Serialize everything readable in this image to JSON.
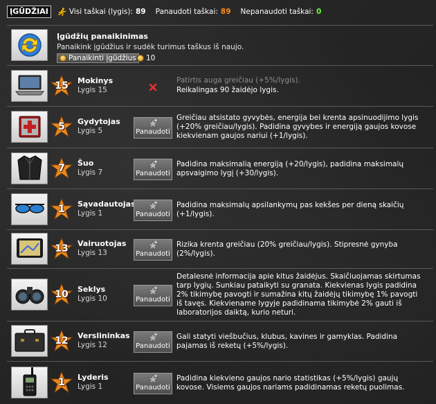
{
  "header": {
    "title": "ĮGŪDŽIAI",
    "total_label": "Visi taškai (lygis):",
    "total_value": "89",
    "used_label": "Panaudoti taškai:",
    "used_value": "89",
    "unused_label": "Nepanaudoti taškai:",
    "unused_value": "0",
    "colors": {
      "used_value": "#ff8c1a",
      "unused_value": "#66ff33"
    }
  },
  "refresh": {
    "title": "Įgūdžių panaikinimas",
    "text": "Panaikink įgūdžius ir sudėk turimus taškus iš naujo.",
    "button_label": "Panaikinti įgūdžius",
    "cost": "10",
    "icon": "refresh-arrows-icon"
  },
  "skills": [
    {
      "name": "Mokinys",
      "level_text": "Lygis 15",
      "level": "15",
      "icon": "laptop-icon",
      "description": "Patirtis auga greičiau (+5%/lygis).",
      "requirement": "Reikalingas 90 žaidėjo lygis.",
      "locked": true
    },
    {
      "name": "Gydytojas",
      "level_text": "Lygis 5",
      "level": "5",
      "icon": "medkit-icon",
      "button_label": "Panaudoti",
      "description": "Greičiau atsistato gyvybės, energija bei krenta apsinuodijimo lygis (+20% greičiau/lygis). Padidina gyvybes ir energiją gaujos kovose kiekvienam gaujos nariui (+1/lygis)."
    },
    {
      "name": "Šuo",
      "level_text": "Lygis 7",
      "level": "7",
      "icon": "leather-jacket-icon",
      "button_label": "Panaudoti",
      "description": "Padidina maksimalią energiją (+20/lygis), padidina maksimalų apsvaigimo lygį (+30/lygis)."
    },
    {
      "name": "Sąvadautojas",
      "level_text": "Lygis 1",
      "level": "1",
      "icon": "sunglasses-icon",
      "button_label": "Panaudoti",
      "description": "Padidina maksimalų apsilankymų pas kekšes per dieną skaičių (+1/lygis)."
    },
    {
      "name": "Vairuotojas",
      "level_text": "Lygis 13",
      "level": "13",
      "icon": "gps-navigator-icon",
      "button_label": "Panaudoti",
      "description": "Rizika krenta greičiau (20% greičiau/lygis). Stipresnė gynyba (2%/lygis)."
    },
    {
      "name": "Seklys",
      "level_text": "Lygis 10",
      "level": "10",
      "icon": "binoculars-icon",
      "button_label": "Panaudoti",
      "description": "Detalesnė informacija apie kitus žaidėjus. Skaičiuojamas skirtumas tarp lygių. Sunkiau pataikyti su granata. Kiekvienas lygis padidina 2% tikimybę pavogti ir sumažina kitų žaidėjų tikimybę 1% pavogti iš tavęs. Kiekviename lygyje padidinama tikimybė 2% gauti iš laboratorijos daiktą, kurio neturi."
    },
    {
      "name": "Verslininkas",
      "level_text": "Lygis 12",
      "level": "12",
      "icon": "briefcase-icon",
      "button_label": "Panaudoti",
      "description": "Gali statyti viešbučius, klubus, kavines ir gamyklas. Padidina pajamas iš reketų (+5%/lygis)."
    },
    {
      "name": "Lyderis",
      "level_text": "Lygis 1",
      "level": "1",
      "icon": "walkie-talkie-icon",
      "button_label": "Panaudoti",
      "description": "Padidina kiekvieno gaujos nario statistikas (+5%/lygis) gaujų kovose. Visiems gaujos nariams padidinamas reketų puolimas."
    }
  ]
}
